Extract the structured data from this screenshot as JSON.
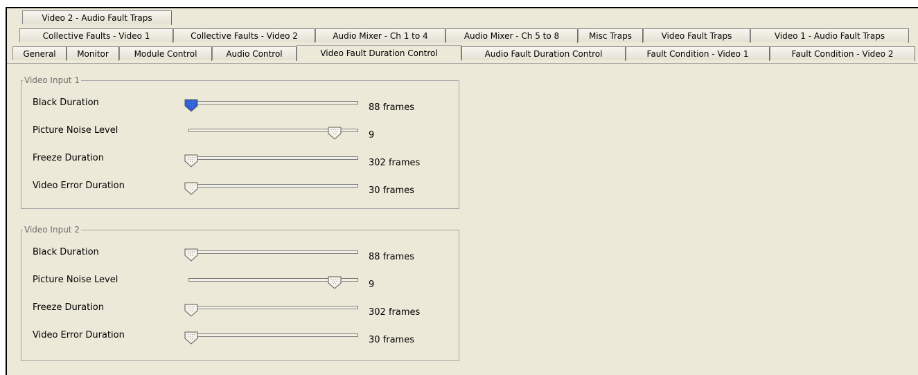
{
  "tabs": {
    "row1": [
      {
        "label": "Video 2 - Audio Fault Traps"
      }
    ],
    "row2": [
      {
        "label": "Collective Faults - Video 1"
      },
      {
        "label": "Collective Faults - Video 2"
      },
      {
        "label": "Audio Mixer - Ch 1 to 4"
      },
      {
        "label": "Audio Mixer - Ch 5 to 8"
      },
      {
        "label": "Misc Traps"
      },
      {
        "label": "Video Fault Traps"
      },
      {
        "label": "Video 1 - Audio Fault Traps"
      }
    ],
    "row3": [
      {
        "label": "General"
      },
      {
        "label": "Monitor"
      },
      {
        "label": "Module Control"
      },
      {
        "label": "Audio Control"
      },
      {
        "label": "Video Fault Duration Control",
        "active": true
      },
      {
        "label": "Audio Fault Duration Control"
      },
      {
        "label": "Fault Condition - Video 1"
      },
      {
        "label": "Fault Condition - Video 2"
      }
    ]
  },
  "groups": [
    {
      "title": "Video Input 1",
      "sliders": [
        {
          "label": "Black Duration",
          "value_text": "88 frames",
          "position": 0.0,
          "focused": true
        },
        {
          "label": "Picture Noise Level",
          "value_text": "9",
          "position": 0.91,
          "focused": false
        },
        {
          "label": "Freeze Duration",
          "value_text": "302 frames",
          "position": 0.0,
          "focused": false
        },
        {
          "label": "Video Error Duration",
          "value_text": "30 frames",
          "position": 0.0,
          "focused": false
        }
      ]
    },
    {
      "title": "Video Input 2",
      "sliders": [
        {
          "label": "Black Duration",
          "value_text": "88 frames",
          "position": 0.0,
          "focused": false
        },
        {
          "label": "Picture Noise Level",
          "value_text": "9",
          "position": 0.91,
          "focused": false
        },
        {
          "label": "Freeze Duration",
          "value_text": "302 frames",
          "position": 0.0,
          "focused": false
        },
        {
          "label": "Video Error Duration",
          "value_text": "30 frames",
          "position": 0.0,
          "focused": false
        }
      ]
    }
  ],
  "colors": {
    "panel_bg": "#ece9d8",
    "thumb_focused": "#2f5fd6",
    "thumb_normal": "#f4f2ea"
  }
}
